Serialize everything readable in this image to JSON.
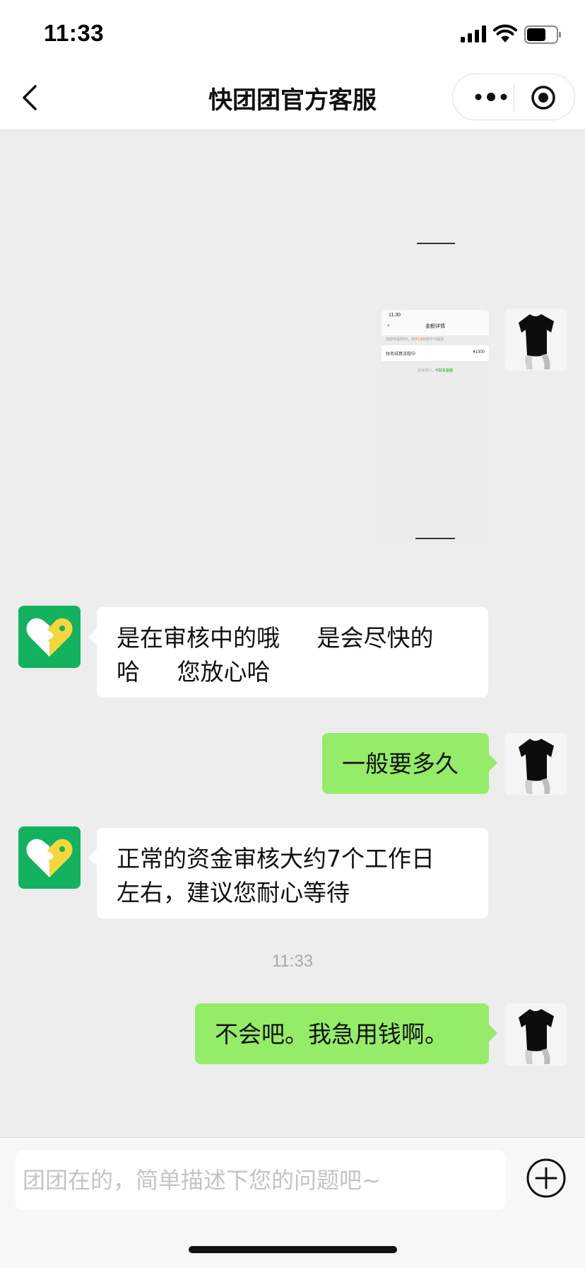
{
  "status_bar": {
    "time": "11:33",
    "icons": [
      "signal-icon",
      "wifi-icon",
      "battery-icon"
    ]
  },
  "nav": {
    "title": "快团团官方客服",
    "back_icon": "chevron-left-icon",
    "more_icon": "more-dots-icon",
    "close_icon": "target-close-icon"
  },
  "colors": {
    "bubble_self": "#95ec69",
    "bubble_other": "#ffffff",
    "service_avatar": "#13b25f",
    "background": "#ededed"
  },
  "shared_image": {
    "status_time": "11:30",
    "title": "金额详情",
    "notice_prefix": "当前可提现¥0，有",
    "notice_highlight": "¥1300",
    "notice_suffix": "暂不可提现",
    "row_label": "财务结算流程中",
    "row_amount": "¥1300",
    "footer_prefix": "如有疑问，",
    "footer_link": "可联系客服"
  },
  "messages": [
    {
      "from": "service",
      "text_lines": [
        "是在审核中的哦     是会尽快的",
        "哈     您放心哈"
      ]
    },
    {
      "from": "self",
      "text": "一般要多久"
    },
    {
      "from": "service",
      "text_lines": [
        "正常的资金审核大约7个工作日",
        "左右，建议您耐心等待"
      ]
    },
    {
      "from": "self",
      "text": "不会吧。我急用钱啊。"
    }
  ],
  "timestamp": "11:33",
  "input": {
    "placeholder": "团团在的，简单描述下您的问题吧~",
    "value": ""
  },
  "plus_icon": "plus-circle-icon"
}
